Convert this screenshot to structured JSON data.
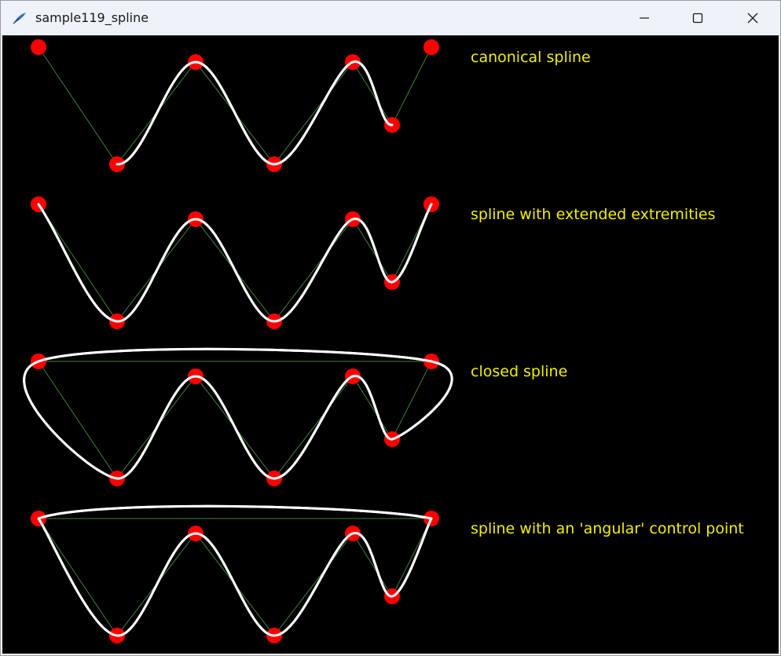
{
  "window": {
    "title": "sample119_spline",
    "icon": "feather-icon",
    "controls": [
      "minimize-icon",
      "maximize-icon",
      "close-icon"
    ]
  },
  "colors": {
    "background": "#000000",
    "control_point": "#ff0000",
    "spline": "#ffffff",
    "polygon": "#3f7f3f",
    "label": "#f2ef00"
  },
  "demos": [
    {
      "label": "canonical spline",
      "mode": "canonical"
    },
    {
      "label": "spline with extended extremities",
      "mode": "extended"
    },
    {
      "label": "closed spline",
      "mode": "closed"
    },
    {
      "label": "spline with an 'angular' control point",
      "mode": "angular"
    }
  ]
}
